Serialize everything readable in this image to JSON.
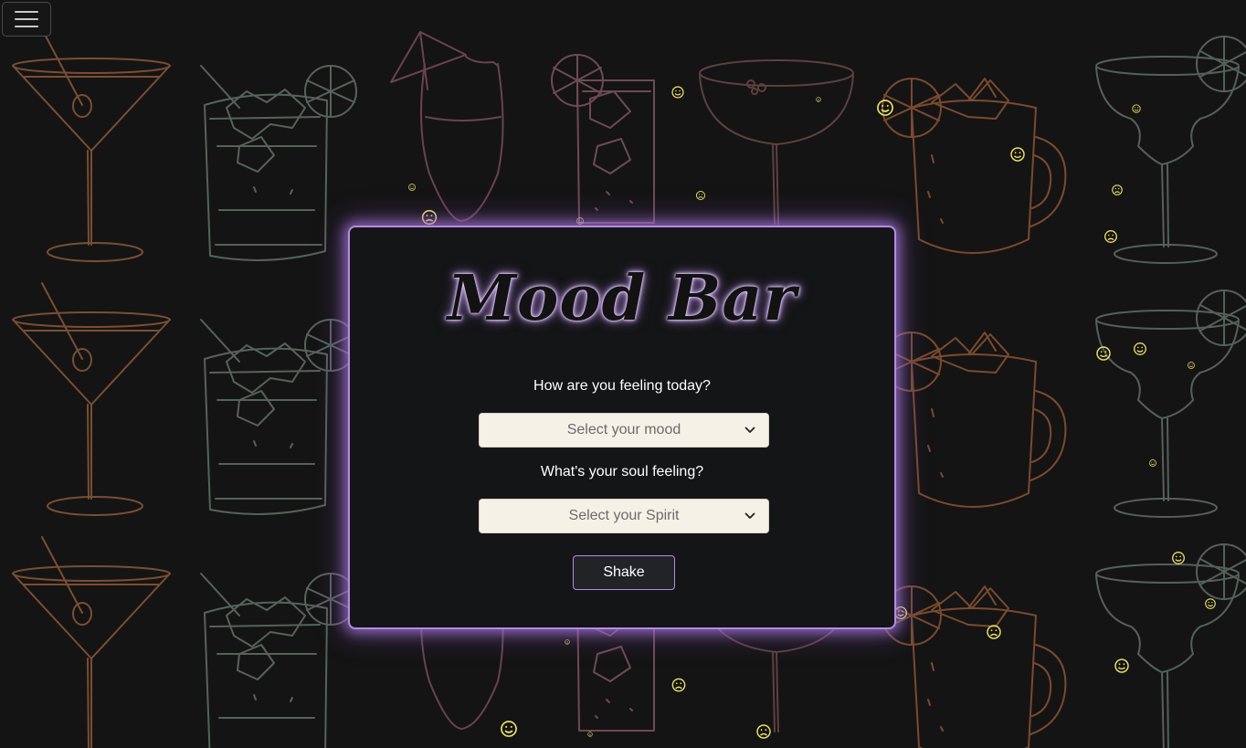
{
  "menu": {
    "icon": "hamburger-icon"
  },
  "app": {
    "title": "Mood Bar"
  },
  "form": {
    "mood_question": "How are you feeling today?",
    "mood_placeholder": "Select your mood",
    "spirit_question": "What's your soul feeling?",
    "spirit_placeholder": "Select your Spirit",
    "shake_label": "Shake"
  },
  "background": {
    "theme": "cocktail line-art pattern with floating smiley and frowny faces",
    "colors": {
      "page": "#141414",
      "martini": "#7a4e33",
      "rocks": "#56625a",
      "hurricane": "#6a4250",
      "highball": "#6e4a55",
      "coupe": "#5e4040",
      "mule": "#7a4a2e",
      "margarita": "#55605a",
      "faces": "#e8dc6a"
    }
  },
  "colors": {
    "accent_glow": "#b48be0",
    "card_bg": "#141517",
    "select_bg": "#f6f1e7"
  }
}
